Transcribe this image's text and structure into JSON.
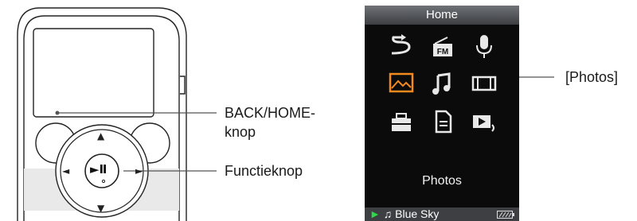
{
  "screen": {
    "title": "Home",
    "selected_label": "Photos",
    "status_track": "♫ Blue Sky",
    "status_play_glyph": "►",
    "highlight_color": "#f28a1e",
    "icons": [
      "shuffle-icon",
      "fm-radio-icon",
      "microphone-icon",
      "photos-icon",
      "music-icon",
      "video-icon",
      "settings-toolbox-icon",
      "playlist-document-icon",
      "now-playing-icon"
    ]
  },
  "device": {
    "center_button_label": "►Ⅱ",
    "up_arrow": "▲",
    "down_arrow": "▼",
    "left_arrow": "◄",
    "right_arrow": "►"
  },
  "callouts": {
    "back_home_line1": "BACK/HOME-",
    "back_home_line2": "knop",
    "function_button": "Functieknop",
    "photos": "[Photos]"
  }
}
